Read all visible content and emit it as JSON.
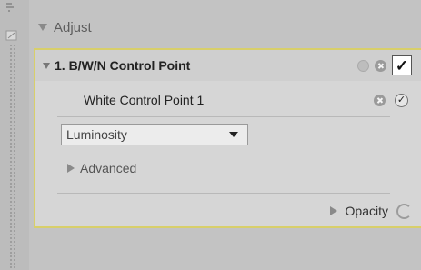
{
  "adjust": {
    "label": "Adjust"
  },
  "control_point": {
    "title": "1. B/W/N Control Point",
    "checked": true
  },
  "white_point": {
    "label": "White Control Point 1",
    "checked": true
  },
  "mode_select": {
    "selected": "Luminosity"
  },
  "advanced": {
    "label": "Advanced"
  },
  "opacity": {
    "label": "Opacity"
  },
  "colors": {
    "panel_border": "#d8cf6a",
    "panel_bg": "#d6d6d6",
    "background": "#c3c3c3"
  },
  "icons": [
    "expand-triangle-icon",
    "collapse-triangle-icon",
    "close-icon",
    "checkmark-icon",
    "circle-check-icon",
    "opacity-dial-icon"
  ]
}
